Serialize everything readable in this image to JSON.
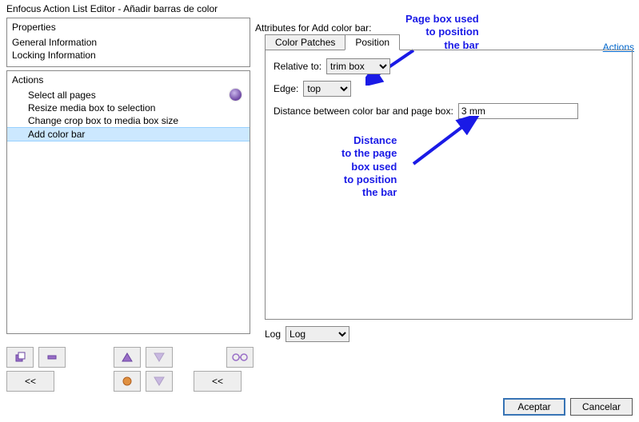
{
  "window": {
    "title": "Enfocus Action List Editor - Añadir barras de color"
  },
  "properties": {
    "title": "Properties",
    "items": [
      "General Information",
      "Locking Information"
    ]
  },
  "actions": {
    "title": "Actions",
    "items": [
      "Select all pages",
      "Resize media box to selection",
      "Change crop box to media box size",
      "Add color bar"
    ],
    "selectedIndex": 3
  },
  "attributes": {
    "label": "Attributes for Add color bar:",
    "link": "Actions",
    "tabs": [
      "Color Patches",
      "Position"
    ],
    "activeTab": 1,
    "relativeTo": {
      "label": "Relative to:",
      "value": "trim box",
      "options": [
        "trim box"
      ]
    },
    "edge": {
      "label": "Edge:",
      "value": "top",
      "options": [
        "top"
      ]
    },
    "distance": {
      "label": "Distance between color bar and page box:",
      "value": "3 mm"
    }
  },
  "log": {
    "label": "Log",
    "value": "Log",
    "options": [
      "Log"
    ]
  },
  "toolbar": {
    "rewind": "<<"
  },
  "buttons": {
    "accept": "Aceptar",
    "cancel": "Cancelar"
  },
  "annotations": {
    "top": "Page box used\nto position\nthe bar",
    "bottom": "Distance\nto the page\nbox used\nto position\nthe bar"
  }
}
